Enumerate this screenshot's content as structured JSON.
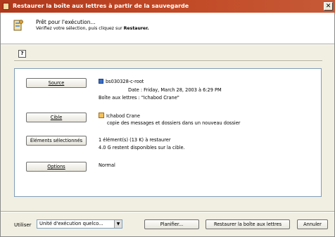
{
  "window": {
    "title": "Restaurer la boîte aux lettres à partir de la sauvegarde",
    "close_symbol": "✕"
  },
  "header": {
    "title": "Prêt pour l'exécution...",
    "subtitle_prefix": "Vérifiez votre sélection, puis cliquez sur ",
    "subtitle_bold": "Restaurer."
  },
  "help_button": "?",
  "panel": {
    "source_button": "Source",
    "source_name": "bs030328-c-root",
    "source_date": "Date : Friday, March 28, 2003 à 6:29 PM",
    "source_mailbox": "Boîte aux lettres : \"Ichabod Crane\"",
    "target_button": "Cible",
    "target_name": "Ichabod Crane",
    "target_desc": "copie des messages et dossiers dans un nouveau dossier",
    "selected_button": "Éléments sélectionnés",
    "selected_line1": "1 élément(s) (13 K) à restaurer",
    "selected_line2": "4.0 G restent disponibles sur la cible.",
    "options_button": "Options",
    "options_value": "Normal"
  },
  "footer": {
    "use_label": "Utiliser",
    "dropdown_value": "Unité d'exécution quelco...",
    "dropdown_arrow": "▼",
    "schedule_button": "Planifier...",
    "restore_button": "Restaurer la boîte aux lettres",
    "cancel_button": "Annuler"
  },
  "icons": {
    "app": "app-icon",
    "header": "wizard-icon",
    "source": "database-icon",
    "target": "user-mailbox-icon"
  }
}
